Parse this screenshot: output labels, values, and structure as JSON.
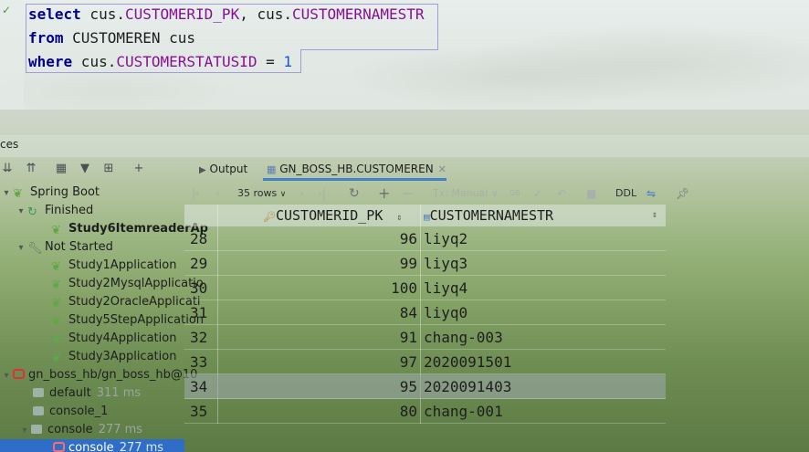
{
  "editor": {
    "line1": {
      "kw": "select",
      "t1": " cus.",
      "c1": "CUSTOMERID_PK",
      "t2": ", cus.",
      "c2": "CUSTOMERNAMESTR"
    },
    "line2": {
      "kw": "from",
      "t1": " CUSTOMEREN cus"
    },
    "line3": {
      "kw": "where",
      "t1": " cus.",
      "c1": "CUSTOMERSTATUSID",
      "t2": " = ",
      "n1": "1"
    }
  },
  "panel": {
    "title": "ces"
  },
  "tree": {
    "spring_boot": "Spring Boot",
    "finished": "Finished",
    "finished_app": "Study6ItemreaderAp",
    "not_started": "Not Started",
    "apps": [
      "Study1Application",
      "Study2MysqlApplicatio",
      "Study2OracleApplicati",
      "Study5StepApplication",
      "Study4Application",
      "Study3Application"
    ],
    "db": "gn_boss_hb/gn_boss_hb@10",
    "default": "default",
    "default_ms": "311 ms",
    "console_1": "console_1",
    "console": "console",
    "console_ms": "277 ms",
    "console_child": "console",
    "console_child_ms": "277 ms"
  },
  "tabs": {
    "output": "Output",
    "table": "GN_BOSS_HB.CUSTOMEREN"
  },
  "toolbar": {
    "rows": "35 rows",
    "tx": "Tx: Manual",
    "ddl": "DDL"
  },
  "grid": {
    "columns": [
      "CUSTOMERID_PK",
      "CUSTOMERNAMESTR"
    ],
    "rows": [
      {
        "n": "28",
        "id": "96",
        "name": "liyq2"
      },
      {
        "n": "29",
        "id": "99",
        "name": "liyq3"
      },
      {
        "n": "30",
        "id": "100",
        "name": "liyq4"
      },
      {
        "n": "31",
        "id": "84",
        "name": "liyq0"
      },
      {
        "n": "32",
        "id": "91",
        "name": "chang-003"
      },
      {
        "n": "33",
        "id": "97",
        "name": "2020091501"
      },
      {
        "n": "34",
        "id": "95",
        "name": "2020091403"
      },
      {
        "n": "35",
        "id": "80",
        "name": "chang-001"
      }
    ]
  }
}
